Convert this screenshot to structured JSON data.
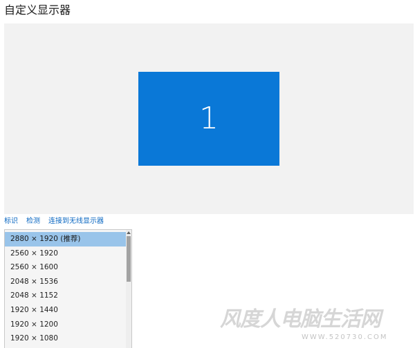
{
  "page": {
    "title": "自定义显示器"
  },
  "display": {
    "number": "1",
    "accent_color": "#0a78d7",
    "panel_color": "#f2f2f2"
  },
  "links": [
    {
      "label": "标识"
    },
    {
      "label": "检测"
    },
    {
      "label": "连接到无线显示器"
    }
  ],
  "resolution_list": {
    "items": [
      {
        "label": "2880 × 1920 (推荐)",
        "selected": true
      },
      {
        "label": "2560 × 1920",
        "selected": false
      },
      {
        "label": "2560 × 1600",
        "selected": false
      },
      {
        "label": "2048 × 1536",
        "selected": false
      },
      {
        "label": "2048 × 1152",
        "selected": false
      },
      {
        "label": "1920 × 1440",
        "selected": false
      },
      {
        "label": "1920 × 1200",
        "selected": false
      },
      {
        "label": "1920 × 1080",
        "selected": false
      }
    ],
    "selected_color": "#99c4ea"
  },
  "watermark": {
    "text": "风度人电脑生活网",
    "url": "WWW.520730.COM"
  }
}
